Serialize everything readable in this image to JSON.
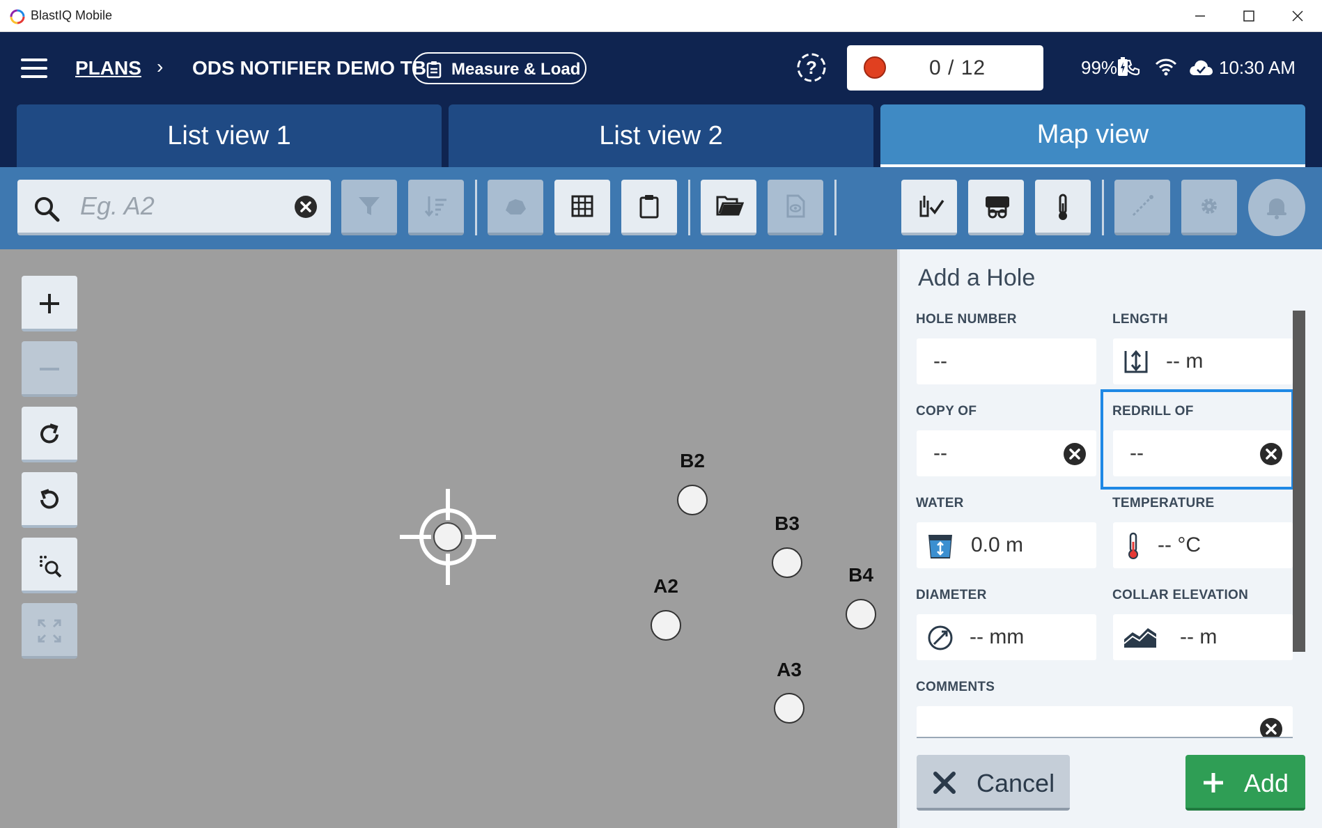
{
  "window": {
    "title": "BlastIQ Mobile"
  },
  "header": {
    "breadcrumb_root": "PLANS",
    "breadcrumb_sep": "›",
    "plan_name": "ODS NOTIFIER DEMO TB",
    "mode_label": "Measure & Load",
    "record_count": "0 / 12",
    "battery": "99%",
    "time": "10:30 AM"
  },
  "tabs": [
    {
      "label": "List view 1",
      "active": false
    },
    {
      "label": "List view 2",
      "active": false
    },
    {
      "label": "Map view",
      "active": true
    }
  ],
  "search": {
    "placeholder": "Eg. A2",
    "value": ""
  },
  "map": {
    "holes": [
      {
        "label": "B2"
      },
      {
        "label": "B3"
      },
      {
        "label": "A2"
      },
      {
        "label": "B4"
      },
      {
        "label": "A3"
      }
    ]
  },
  "panel": {
    "title": "Add a Hole",
    "hole_number": {
      "label": "HOLE NUMBER",
      "value": "--"
    },
    "length": {
      "label": "LENGTH",
      "value": "--  m"
    },
    "copy_of": {
      "label": "COPY OF",
      "value": "--"
    },
    "redrill_of": {
      "label": "REDRILL OF",
      "value": "--"
    },
    "water": {
      "label": "WATER",
      "value": "0.0 m"
    },
    "temperature": {
      "label": "TEMPERATURE",
      "value": "-- °C"
    },
    "diameter": {
      "label": "DIAMETER",
      "value": "--  mm"
    },
    "collar_elevation": {
      "label": "COLLAR ELEVATION",
      "value": "-- m"
    },
    "comments": {
      "label": "COMMENTS",
      "value": ""
    },
    "cancel_label": "Cancel",
    "add_label": "Add"
  },
  "colors": {
    "header_bg": "#0f2450",
    "tab_bg": "#1f4a84",
    "tab_active": "#3f8ac4",
    "toolbar_bg": "#3e78b0",
    "map_bg": "#9e9e9e",
    "add_green": "#2f9e55",
    "highlight_blue": "#1e88e5",
    "record_red": "#e04020"
  }
}
